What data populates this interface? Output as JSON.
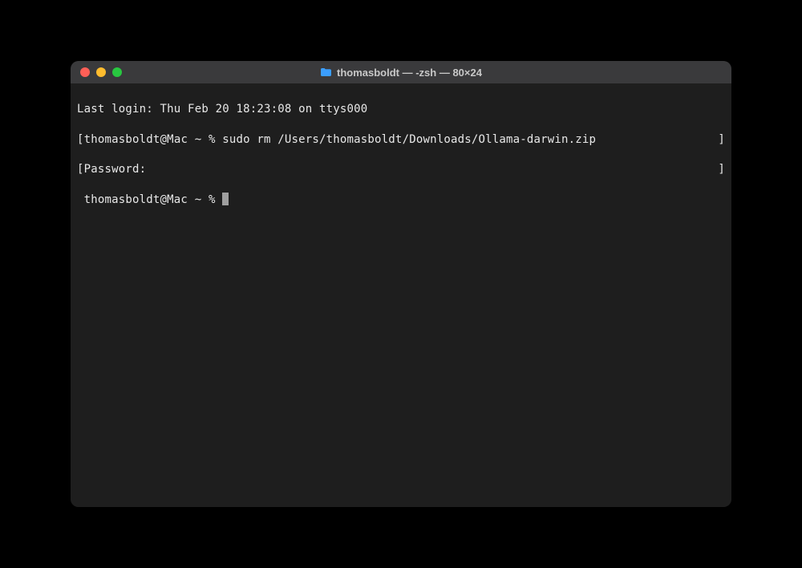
{
  "window": {
    "title": "thomasboldt — -zsh — 80×24"
  },
  "terminal": {
    "line1": "Last login: Thu Feb 20 18:23:08 on ttys000",
    "line2_left_bracket": "[",
    "line2_prompt": "thomasboldt@Mac ~ % ",
    "line2_command": "sudo rm /Users/thomasboldt/Downloads/Ollama-darwin.zip",
    "line2_right_bracket": "]",
    "line3_left_bracket": "[",
    "line3_text": "Password:",
    "line3_right_bracket": "]",
    "line4_prompt": " thomasboldt@Mac ~ % "
  }
}
